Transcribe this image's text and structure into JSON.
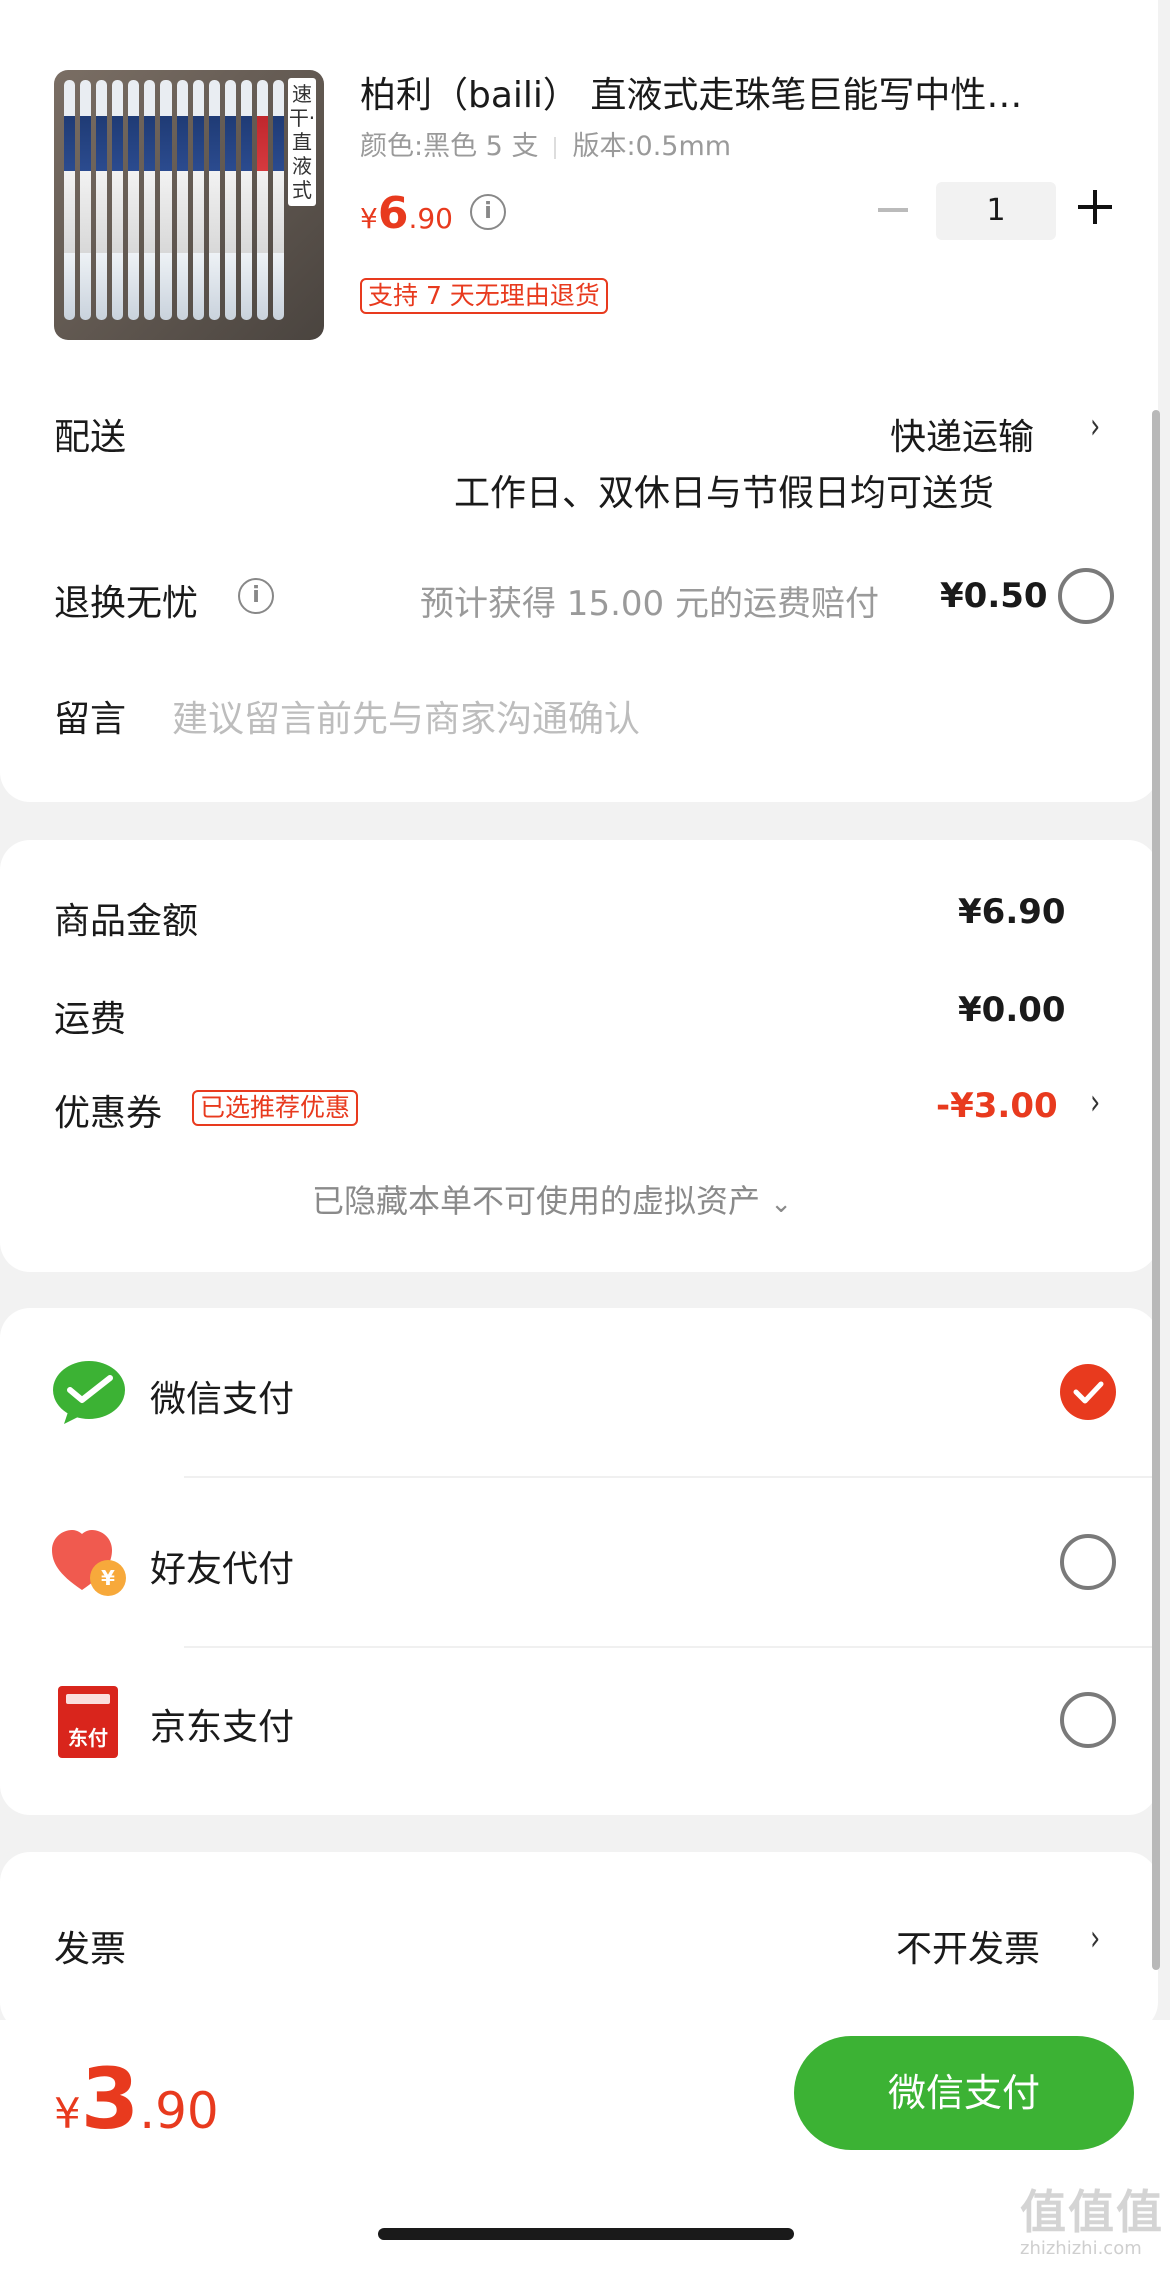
{
  "product": {
    "thumb_tag": "速干·直液式",
    "title": "柏利（baili） 直液式走珠笔巨能写中性…",
    "spec_color": "颜色:黑色 5 支",
    "spec_version": "版本:0.5mm",
    "price_currency": "¥",
    "price_int": "6",
    "price_dec": ".90",
    "return_tag": "支持 7 天无理由退货",
    "quantity": "1"
  },
  "delivery": {
    "label": "配送",
    "method": "快递运输",
    "note": "工作日、双休日与节假日均可送货"
  },
  "return_worry": {
    "label": "退换无忧",
    "desc": "预计获得 15.00 元的运费赔付",
    "price": "¥0.50"
  },
  "message": {
    "label": "留言",
    "placeholder": "建议留言前先与商家沟通确认"
  },
  "summary": {
    "goods_label": "商品金额",
    "goods_value": "¥6.90",
    "shipping_label": "运费",
    "shipping_value": "¥0.00",
    "coupon_label": "优惠券",
    "coupon_tag": "已选推荐优惠",
    "coupon_value": "-¥3.00",
    "hidden_assets": "已隐藏本单不可使用的虚拟资产"
  },
  "payment": {
    "methods": [
      {
        "label": "微信支付",
        "icon": "wechat-pay-icon",
        "selected": true
      },
      {
        "label": "好友代付",
        "icon": "friend-pay-icon",
        "selected": false
      },
      {
        "label": "京东支付",
        "icon": "jd-pay-icon",
        "selected": false
      }
    ],
    "jd_icon_text": "东付",
    "friend_icon_text": "¥"
  },
  "invoice": {
    "label": "发票",
    "value": "不开发票"
  },
  "footer": {
    "currency": "¥",
    "total_int": "3",
    "total_dec": ".90",
    "pay_button": "微信支付"
  },
  "watermark": {
    "logo": "值值值",
    "site": "zhizhizhi.com"
  },
  "colors": {
    "accent_red": "#e83a1e",
    "wechat_green": "#3cb234"
  }
}
